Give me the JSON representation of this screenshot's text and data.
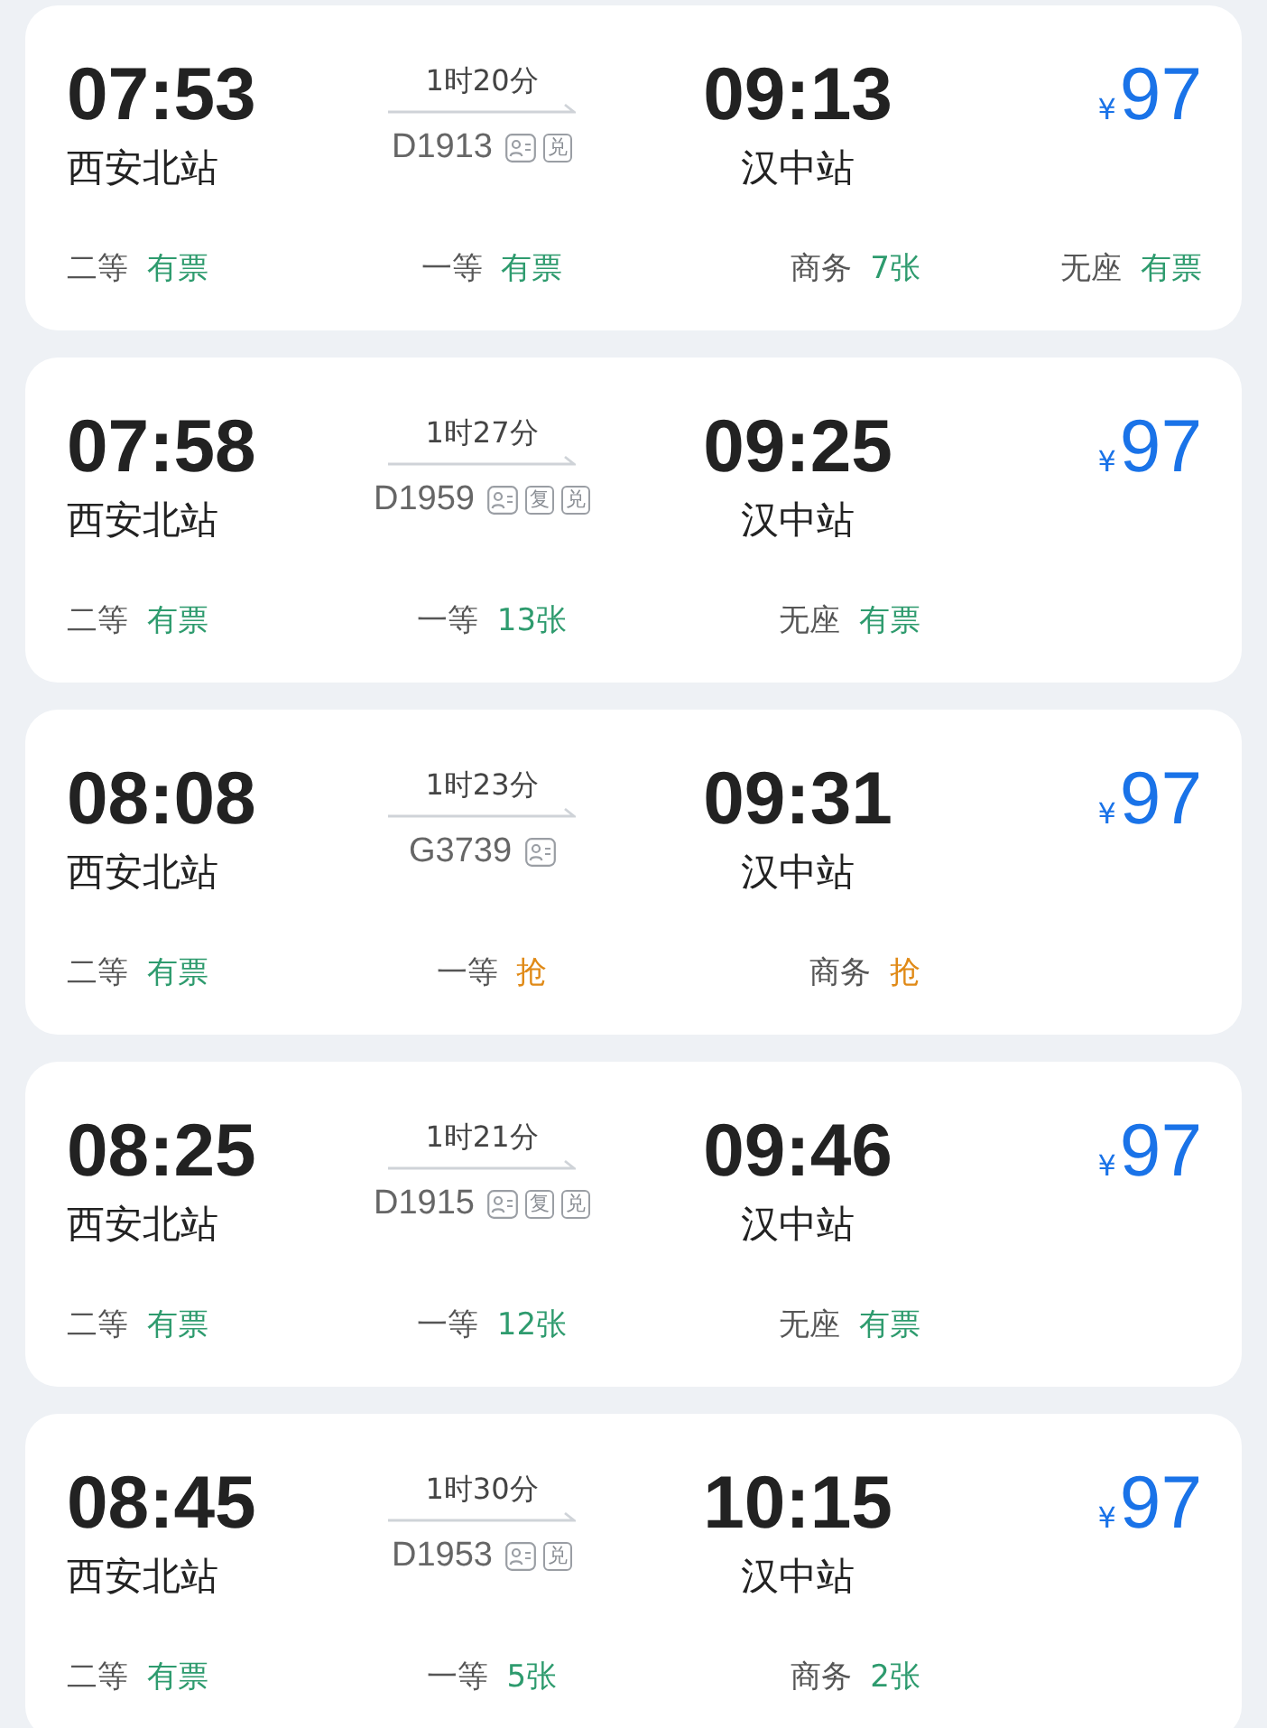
{
  "trains": [
    {
      "depart_time": "07:53",
      "depart_station": "西安北站",
      "duration": "1时20分",
      "train_no": "D1913",
      "tags": [
        {
          "kind": "id"
        },
        {
          "kind": "label",
          "text": "兑"
        }
      ],
      "arrive_time": "09:13",
      "arrive_station": "汉中站",
      "currency": "¥",
      "price": "97",
      "seats": [
        {
          "class": "二等",
          "status": "有票",
          "color": "#2e9b6e"
        },
        {
          "class": "一等",
          "status": "有票",
          "color": "#2e9b6e"
        },
        {
          "class": "商务",
          "status": "7张",
          "color": "#2e9b6e"
        },
        {
          "class": "无座",
          "status": "有票",
          "color": "#2e9b6e"
        }
      ]
    },
    {
      "depart_time": "07:58",
      "depart_station": "西安北站",
      "duration": "1时27分",
      "train_no": "D1959",
      "tags": [
        {
          "kind": "id"
        },
        {
          "kind": "label",
          "text": "复"
        },
        {
          "kind": "label",
          "text": "兑"
        }
      ],
      "arrive_time": "09:25",
      "arrive_station": "汉中站",
      "currency": "¥",
      "price": "97",
      "seats": [
        {
          "class": "二等",
          "status": "有票",
          "color": "#2e9b6e"
        },
        {
          "class": "一等",
          "status": "13张",
          "color": "#2e9b6e"
        },
        {
          "class": "无座",
          "status": "有票",
          "color": "#2e9b6e"
        }
      ]
    },
    {
      "depart_time": "08:08",
      "depart_station": "西安北站",
      "duration": "1时23分",
      "train_no": "G3739",
      "tags": [
        {
          "kind": "id"
        }
      ],
      "arrive_time": "09:31",
      "arrive_station": "汉中站",
      "currency": "¥",
      "price": "97",
      "seats": [
        {
          "class": "二等",
          "status": "有票",
          "color": "#2e9b6e"
        },
        {
          "class": "一等",
          "status": "抢",
          "color": "#e08a17"
        },
        {
          "class": "商务",
          "status": "抢",
          "color": "#e08a17"
        }
      ]
    },
    {
      "depart_time": "08:25",
      "depart_station": "西安北站",
      "duration": "1时21分",
      "train_no": "D1915",
      "tags": [
        {
          "kind": "id"
        },
        {
          "kind": "label",
          "text": "复"
        },
        {
          "kind": "label",
          "text": "兑"
        }
      ],
      "arrive_time": "09:46",
      "arrive_station": "汉中站",
      "currency": "¥",
      "price": "97",
      "seats": [
        {
          "class": "二等",
          "status": "有票",
          "color": "#2e9b6e"
        },
        {
          "class": "一等",
          "status": "12张",
          "color": "#2e9b6e"
        },
        {
          "class": "无座",
          "status": "有票",
          "color": "#2e9b6e"
        }
      ]
    },
    {
      "depart_time": "08:45",
      "depart_station": "西安北站",
      "duration": "1时30分",
      "train_no": "D1953",
      "tags": [
        {
          "kind": "id"
        },
        {
          "kind": "label",
          "text": "兑"
        }
      ],
      "arrive_time": "10:15",
      "arrive_station": "汉中站",
      "currency": "¥",
      "price": "97",
      "seats": [
        {
          "class": "二等",
          "status": "有票",
          "color": "#2e9b6e"
        },
        {
          "class": "一等",
          "status": "5张",
          "color": "#2e9b6e"
        },
        {
          "class": "商务",
          "status": "2张",
          "color": "#2e9b6e"
        }
      ]
    }
  ]
}
